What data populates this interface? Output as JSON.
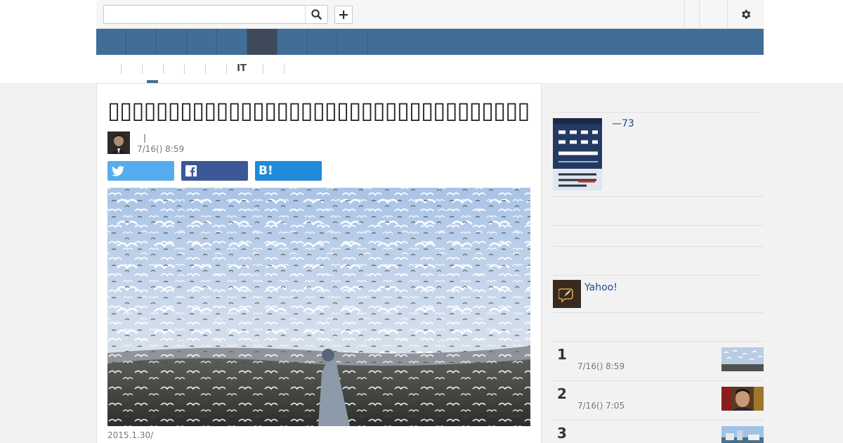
{
  "header": {
    "search_placeholder": "",
    "search_value": ""
  },
  "categories": {
    "it_label": "IT"
  },
  "article": {
    "headline": "▯▯▯▯▯▯▯▯▯▯▯▯▯▯▯▯▯▯▯▯▯▯▯▯▯▯▯▯▯▯▯▯▯▯▯▯▯▯▯▯▯▯▯▯▯▯▯▯▯▯▯▯▯▯▯▯▯▯▯▯▯▯▯▯▯▯▯▯",
    "author_separator": "|",
    "date": "7/16() 8:59",
    "caption": "2015.1.30/"
  },
  "share": {
    "hatena_label": "B!"
  },
  "sidebar": {
    "book_title": "—73",
    "yahoo_label": "Yahoo!",
    "ranking": [
      {
        "rank": "1",
        "date": "7/16() 8:59"
      },
      {
        "rank": "2",
        "date": "7/16() 7:05"
      },
      {
        "rank": "3",
        "date": ""
      }
    ]
  },
  "colors": {
    "nav_blue": "#416e97",
    "nav_active": "#3e4a5a",
    "twitter": "#55acee",
    "facebook": "#3b5998",
    "hatena": "#1f8bd9",
    "link": "#1a4a8a"
  },
  "icons": [
    "search-icon",
    "plus-icon",
    "gear-icon",
    "twitter-icon",
    "facebook-icon",
    "hatena-icon",
    "quill-icon"
  ]
}
